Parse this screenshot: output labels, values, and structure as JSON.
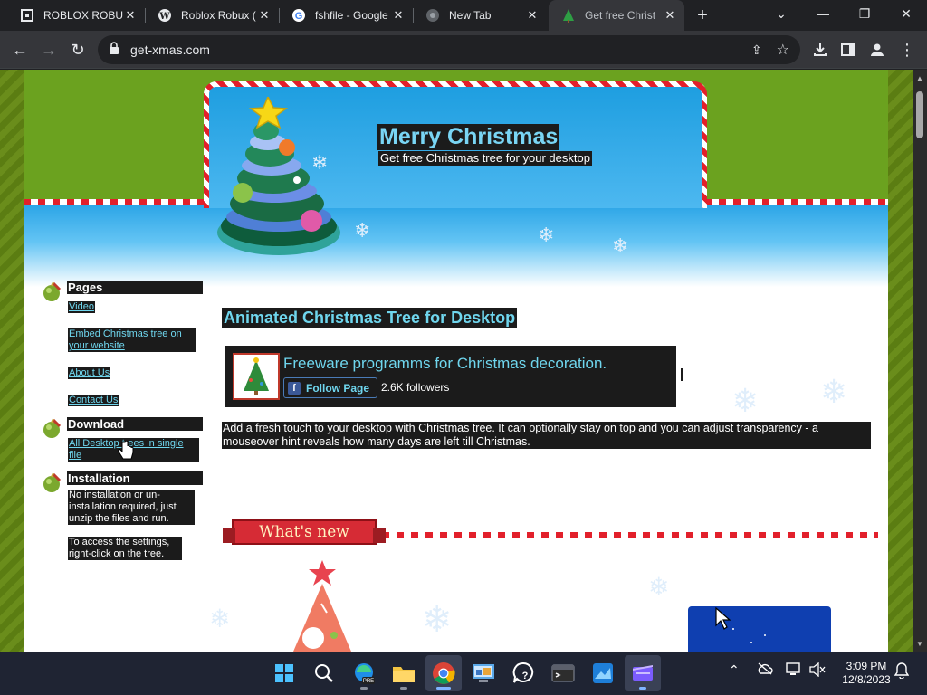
{
  "browser": {
    "tabs": [
      {
        "title": "ROBLOX ROBUX",
        "icon": "roblox-icon",
        "active": false
      },
      {
        "title": "Roblox Robux (",
        "icon": "wordpress-icon",
        "active": false
      },
      {
        "title": "fshfile - Google",
        "icon": "google-icon",
        "active": false
      },
      {
        "title": "New Tab",
        "icon": "newtab-icon",
        "active": false
      },
      {
        "title": "Get free Christ",
        "icon": "christmas-tree-icon",
        "active": true
      }
    ],
    "url": "get-xmas.com"
  },
  "site": {
    "title": "Merry Christmas",
    "subtitle": "Get free Christmas tree for your desktop"
  },
  "sidebar": {
    "pages": {
      "heading": "Pages",
      "links": [
        "Video",
        "Embed Christmas tree on your website",
        "About Us",
        "Contact Us"
      ]
    },
    "download": {
      "heading": "Download",
      "link": "All Desktop trees in single file"
    },
    "installation": {
      "heading": "Installation",
      "text1": "No installation or un-installation required, just unzip the files and run.",
      "text2": "To access the settings, right-click on the tree."
    }
  },
  "main": {
    "heading": "Animated Christmas Tree for Desktop",
    "facebook": {
      "title": "Freeware programms for Christmas decoration.",
      "button": "Follow Page",
      "followers": "2.6K followers"
    },
    "description": "Add a fresh touch to your desktop with Christmas tree. It can optionally stay on top and you can adjust transparency - a mouseover hint reveals how many days are left till Christmas.",
    "whats_new": "What's new"
  },
  "taskbar": {
    "time": "3:09 PM",
    "date": "12/8/2023"
  }
}
